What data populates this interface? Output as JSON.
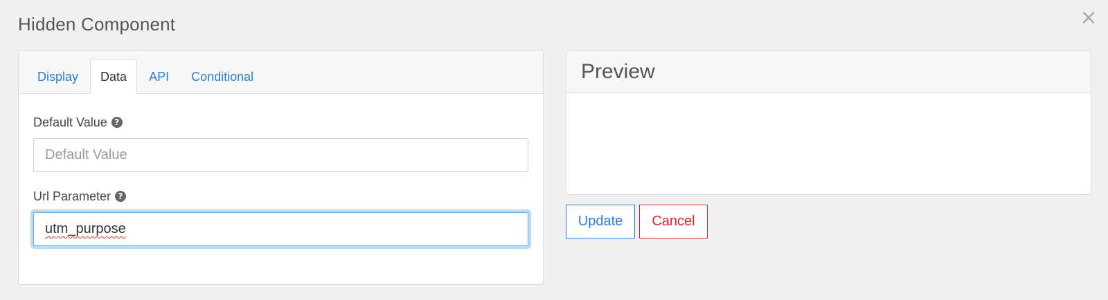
{
  "modal": {
    "title": "Hidden Component",
    "close_glyph": "×"
  },
  "tabs": [
    {
      "label": "Display",
      "active": false
    },
    {
      "label": "Data",
      "active": true
    },
    {
      "label": "API",
      "active": false
    },
    {
      "label": "Conditional",
      "active": false
    }
  ],
  "fields": {
    "default_value": {
      "label": "Default Value",
      "placeholder": "Default Value",
      "value": ""
    },
    "url_parameter": {
      "label": "Url Parameter",
      "value": "utm_purpose"
    }
  },
  "help_glyph": "?",
  "preview": {
    "title": "Preview"
  },
  "buttons": {
    "update": "Update",
    "cancel": "Cancel"
  },
  "colors": {
    "link_blue": "#2a7fd4",
    "danger_red": "#d9232e",
    "focus_blue": "#66afe9"
  },
  "icons": [
    "close-icon",
    "help-icon"
  ]
}
